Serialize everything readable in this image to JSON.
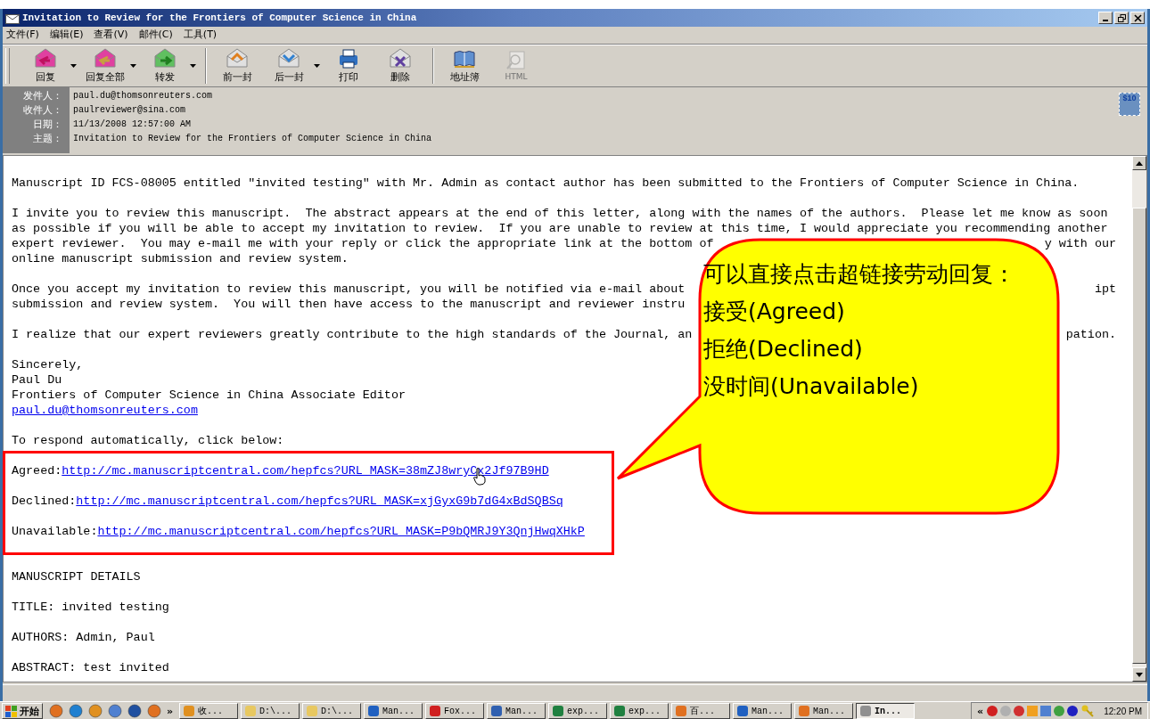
{
  "window": {
    "title": "Invitation to Review for the Frontiers of Computer Science in China"
  },
  "menu": [
    {
      "label": "文件(F)"
    },
    {
      "label": "编辑(E)"
    },
    {
      "label": "查看(V)"
    },
    {
      "label": "邮件(C)"
    },
    {
      "label": "工具(T)"
    }
  ],
  "toolbar": [
    {
      "label": "回复",
      "kind": "reply",
      "dropdown": true,
      "disabled": false,
      "group_end": false
    },
    {
      "label": "回复全部",
      "kind": "reply_all",
      "dropdown": true,
      "disabled": false,
      "group_end": false
    },
    {
      "label": "转发",
      "kind": "forward",
      "dropdown": true,
      "disabled": false,
      "group_end": true
    },
    {
      "label": "前一封",
      "kind": "previous",
      "dropdown": false,
      "disabled": false,
      "group_end": false
    },
    {
      "label": "后一封",
      "kind": "next",
      "dropdown": true,
      "disabled": false,
      "group_end": false
    },
    {
      "label": "打印",
      "kind": "print",
      "dropdown": false,
      "disabled": false,
      "group_end": false
    },
    {
      "label": "删除",
      "kind": "delete",
      "dropdown": false,
      "disabled": false,
      "group_end": true
    },
    {
      "label": "地址簿",
      "kind": "addresses",
      "dropdown": false,
      "disabled": false,
      "group_end": false
    },
    {
      "label": "HTML",
      "kind": "html",
      "dropdown": false,
      "disabled": true,
      "group_end": false
    }
  ],
  "header": {
    "fields": [
      {
        "label": "发件人：",
        "value": "paul.du@thomsonreuters.com"
      },
      {
        "label": "收件人：",
        "value": "paulreviewer@sina.com"
      },
      {
        "label": "日期：",
        "value": "11/13/2008 12:57:00 AM"
      },
      {
        "label": "主题：",
        "value": "Invitation to Review for the Frontiers of Computer Science in China"
      }
    ],
    "stamp": "$10"
  },
  "body": [
    {
      "kind": "text",
      "text": "Manuscript ID FCS-08005 entitled \"invited testing\" with Mr. Admin as contact author has been submitted to the Frontiers of Computer Science in China."
    },
    {
      "kind": "gap"
    },
    {
      "kind": "text",
      "text": "I invite you to review this manuscript.  The abstract appears at the end of this letter, along with the names of the authors.  Please let me know as soon"
    },
    {
      "kind": "text",
      "text": "as possible if you will be able to accept my invitation to review.  If you are unable to review at this time, I would appreciate you recommending another"
    },
    {
      "kind": "split",
      "left": "expert reviewer.  You may e-mail me with your reply or click the appropriate link at the bottom of",
      "right": "y with our"
    },
    {
      "kind": "text",
      "text": "online manuscript submission and review system."
    },
    {
      "kind": "gap"
    },
    {
      "kind": "split",
      "left": "Once you accept my invitation to review this manuscript, you will be notified via e-mail about",
      "right": "ipt"
    },
    {
      "kind": "text",
      "text": "submission and review system.  You will then have access to the manuscript and reviewer instru"
    },
    {
      "kind": "gap"
    },
    {
      "kind": "split",
      "left": "I realize that our expert reviewers greatly contribute to the high standards of the Journal, an",
      "right": "pation."
    },
    {
      "kind": "gap"
    },
    {
      "kind": "text",
      "text": "Sincerely,"
    },
    {
      "kind": "text",
      "text": "Paul Du"
    },
    {
      "kind": "text",
      "text": "Frontiers of Computer Science in China Associate Editor"
    },
    {
      "kind": "link",
      "link": "paul.du@thomsonreuters.com"
    },
    {
      "kind": "gap"
    },
    {
      "kind": "text",
      "text": "To respond automatically, click below:"
    },
    {
      "kind": "gap"
    },
    {
      "kind": "link",
      "label": "Agreed:",
      "link": "http://mc.manuscriptcentral.com/hepfcs?URL_MASK=38mZJ8wryCx2Jf97B9HD"
    },
    {
      "kind": "gap"
    },
    {
      "kind": "link",
      "label": "Declined:",
      "link": "http://mc.manuscriptcentral.com/hepfcs?URL_MASK=xjGyxG9b7dG4xBdSQBSq"
    },
    {
      "kind": "gap"
    },
    {
      "kind": "link",
      "label": "Unavailable:",
      "link": "http://mc.manuscriptcentral.com/hepfcs?URL_MASK=P9bQMRJ9Y3QnjHwqXHkP"
    },
    {
      "kind": "gap"
    },
    {
      "kind": "gap"
    },
    {
      "kind": "text",
      "text": "MANUSCRIPT DETAILS"
    },
    {
      "kind": "gap"
    },
    {
      "kind": "text",
      "text": "TITLE: invited testing"
    },
    {
      "kind": "gap"
    },
    {
      "kind": "text",
      "text": "AUTHORS: Admin, Paul"
    },
    {
      "kind": "gap"
    },
    {
      "kind": "text",
      "text": "ABSTRACT: test invited"
    }
  ],
  "callout": {
    "lines": [
      "可以直接点击超链接劳动回复：",
      "接受(Agreed)",
      "拒绝(Declined)",
      "没时间(Unavailable)"
    ]
  },
  "taskbar": {
    "start": "开始",
    "more": "»",
    "tasks": [
      {
        "label": "收...",
        "kind": "clock",
        "selected": false
      },
      {
        "label": "D:\\...",
        "kind": "folder",
        "selected": false
      },
      {
        "label": "D:\\...",
        "kind": "folder",
        "selected": false
      },
      {
        "label": "Man...",
        "kind": "ie",
        "selected": false
      },
      {
        "label": "Fox...",
        "kind": "foxit",
        "selected": false
      },
      {
        "label": "Man...",
        "kind": "word",
        "selected": false
      },
      {
        "label": "exp...",
        "kind": "excel",
        "selected": false
      },
      {
        "label": "exp...",
        "kind": "excel",
        "selected": false
      },
      {
        "label": "百...",
        "kind": "firefox",
        "selected": false
      },
      {
        "label": "Man...",
        "kind": "ie",
        "selected": false
      },
      {
        "label": "Man...",
        "kind": "firefox",
        "selected": false
      },
      {
        "label": "In...",
        "kind": "mail",
        "selected": true
      }
    ],
    "tray_toggle": "«",
    "clock": "12:20 PM"
  }
}
